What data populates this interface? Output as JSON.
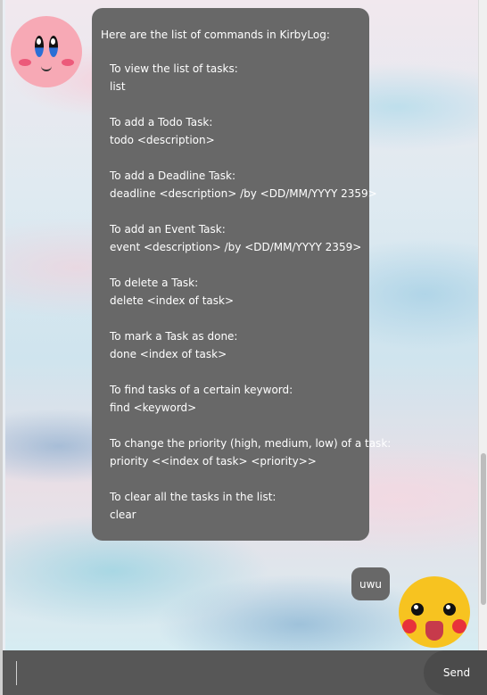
{
  "bot_message": {
    "intro": "Here are the list of commands in KirbyLog:",
    "commands": [
      {
        "title": "To view the list of tasks:",
        "syntax": "list"
      },
      {
        "title": "To add a Todo Task:",
        "syntax": "todo <description>"
      },
      {
        "title": "To add a Deadline Task:",
        "syntax": "deadline <description> /by <DD/MM/YYYY 2359>"
      },
      {
        "title": "To add an Event Task:",
        "syntax": "event <description> /by <DD/MM/YYYY 2359>"
      },
      {
        "title": "To delete a Task:",
        "syntax": "delete <index of task>"
      },
      {
        "title": "To mark a Task as done:",
        "syntax": "done <index of task>"
      },
      {
        "title": "To find tasks of a certain keyword:",
        "syntax": "find <keyword>"
      },
      {
        "title": "To change the priority (high, medium, low) of a task:",
        "syntax": "priority <<index of task> <priority>>"
      },
      {
        "title": "To clear all the tasks in the list:",
        "syntax": "clear"
      }
    ]
  },
  "user_message": {
    "text": "uwu"
  },
  "input": {
    "value": "",
    "placeholder": ""
  },
  "send_button": {
    "label": "Send"
  },
  "avatars": {
    "bot": "kirby-avatar",
    "user": "pikachu-avatar"
  },
  "colors": {
    "bubble": "#686868",
    "input_bar": "#575757",
    "send_button": "#4b4b4b"
  }
}
